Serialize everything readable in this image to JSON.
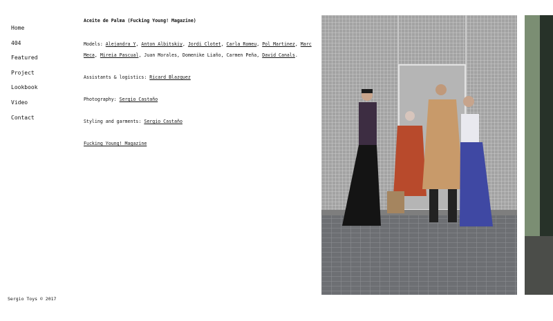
{
  "nav": {
    "items": [
      "Home",
      "404",
      "Featured",
      "Project",
      "Lookbook",
      "Video",
      "Contact"
    ]
  },
  "article": {
    "title": "Aceite de Palma (Fucking Young! Magazine)",
    "models_label": "Models:",
    "models": [
      {
        "name": "Alejandra Y",
        "link": true
      },
      {
        "name": "Anton Albitskiy",
        "link": true
      },
      {
        "name": "Jordi Clotet",
        "link": true
      },
      {
        "name": "Carla Romeu",
        "link": true
      },
      {
        "name": "Pol Martinez",
        "link": true
      },
      {
        "name": "Marc Meca",
        "link": true
      },
      {
        "name": "Mireia Pascual",
        "link": true
      },
      {
        "name": "Juan Morales",
        "link": false
      },
      {
        "name": "Domenike Liaño",
        "link": false
      },
      {
        "name": "Carmen Peña",
        "link": false
      },
      {
        "name": "David Canals",
        "link": true
      }
    ],
    "assistants_label": "Assistants & logistics:",
    "assistants": "Ricard Blazquez",
    "photography_label": "Photography:",
    "photography": "Sergio Castaño",
    "styling_label": "Styling and garments:",
    "styling": "Sergio Castaño",
    "magazine_link": "Fucking Young! Magazine"
  },
  "footer": {
    "copyright": "Sergio Toys © 2017"
  },
  "colors": {
    "text": "#111111",
    "background": "#ffffff"
  }
}
